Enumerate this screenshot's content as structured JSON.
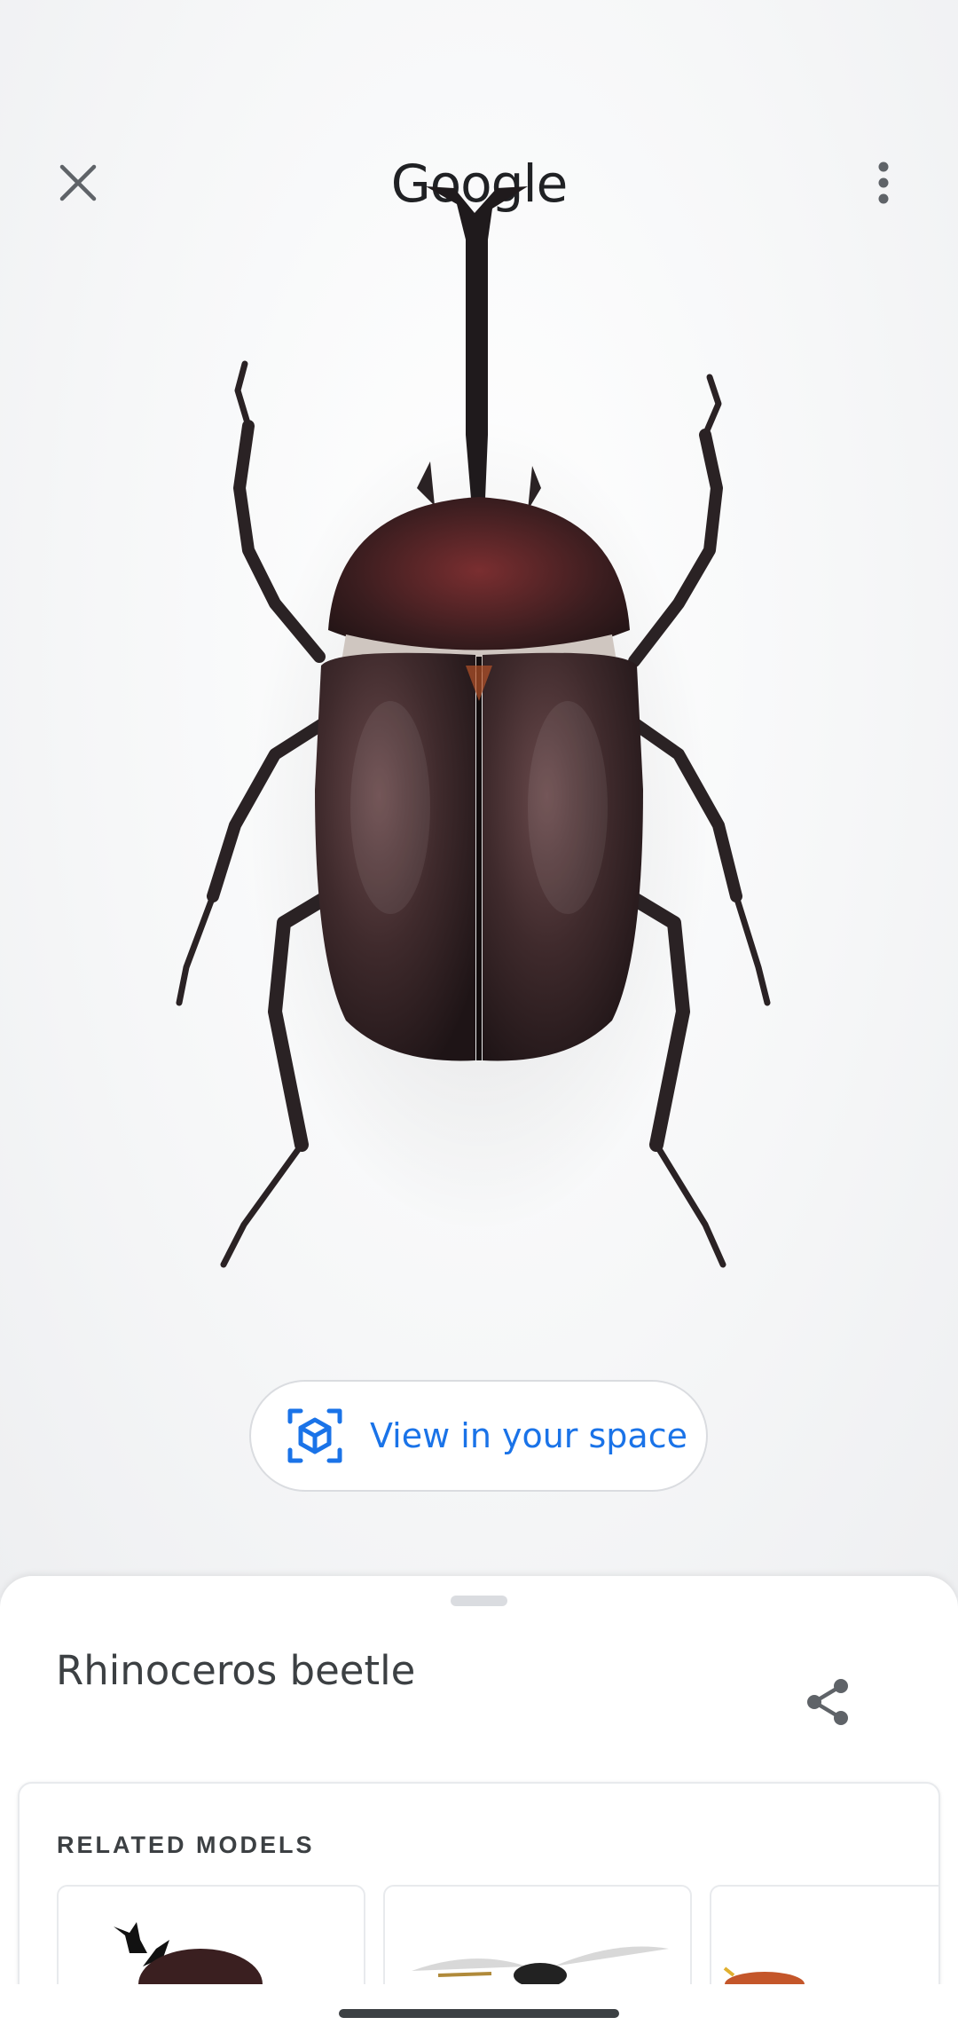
{
  "app": {
    "logo_text": "Google"
  },
  "toolbar": {
    "close_icon": "close-icon",
    "menu_icon": "more-vert-icon"
  },
  "viewer": {
    "model_subject": "rhinoceros beetle 3D model",
    "ar_button": {
      "label": "View in your space",
      "icon": "ar-cube-icon"
    }
  },
  "sheet": {
    "title": "Rhinoceros beetle",
    "share_icon": "share-icon",
    "related": {
      "heading": "RELATED MODELS",
      "items": [
        {
          "name": "stag beetle thumbnail"
        },
        {
          "name": "winged insect thumbnail"
        },
        {
          "name": "orange insect thumbnail"
        }
      ]
    }
  },
  "colors": {
    "accent": "#1a73e8",
    "text_primary": "#3c4043",
    "beetle_body": "#3a2426",
    "border": "#dadce0"
  }
}
